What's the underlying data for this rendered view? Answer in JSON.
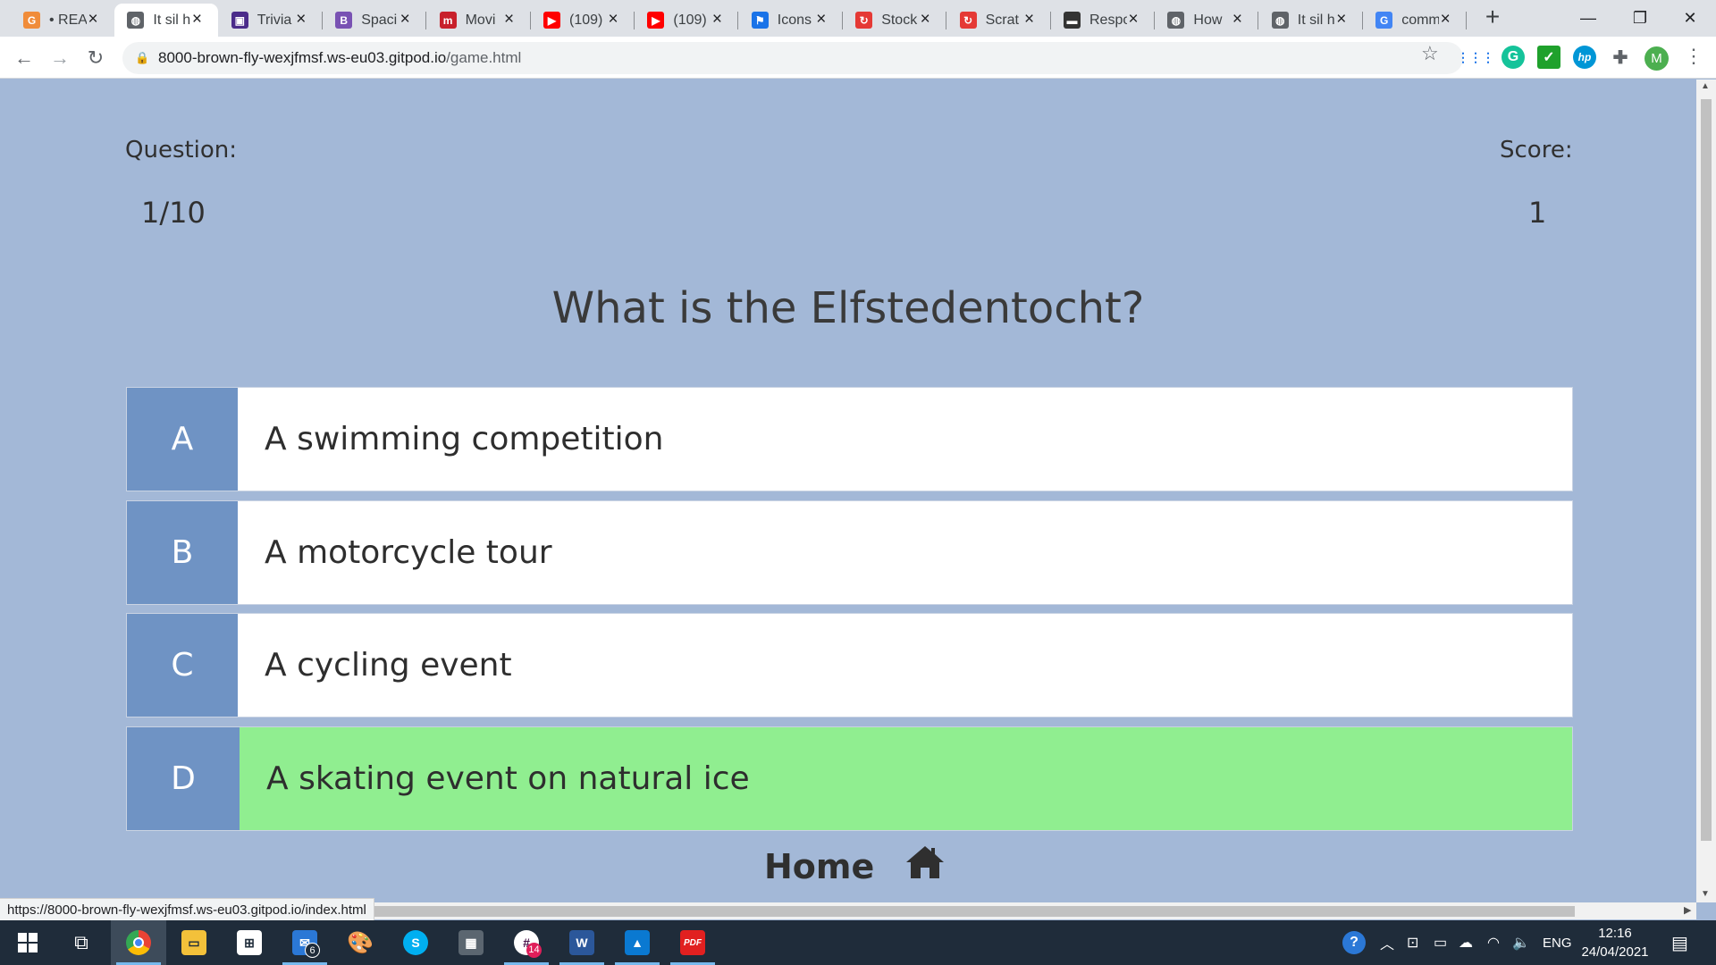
{
  "browser": {
    "tabs": [
      {
        "title": "• REA",
        "favicon": "grammarly-icon",
        "color": "#f08c3a",
        "glyph": "G",
        "active": false
      },
      {
        "title": "It sil h",
        "favicon": "globe-icon",
        "color": "#5f6368",
        "glyph": "◍",
        "active": true
      },
      {
        "title": "Trivia",
        "favicon": "trivia-icon",
        "color": "#4b2c8a",
        "glyph": "▣",
        "active": false
      },
      {
        "title": "Spaci",
        "favicon": "bootstrap-icon",
        "color": "#7952b3",
        "glyph": "B",
        "active": false
      },
      {
        "title": "Movi",
        "favicon": "movie-icon",
        "color": "#c8202b",
        "glyph": "m",
        "active": false
      },
      {
        "title": "(109)",
        "favicon": "youtube-icon",
        "color": "#ff0000",
        "glyph": "▶",
        "active": false
      },
      {
        "title": "(109)",
        "favicon": "youtube-icon",
        "color": "#ff0000",
        "glyph": "▶",
        "active": false
      },
      {
        "title": "Icons",
        "favicon": "flag-icon",
        "color": "#1a73e8",
        "glyph": "⚑",
        "active": false
      },
      {
        "title": "Stock",
        "favicon": "scratch-icon",
        "color": "#e53935",
        "glyph": "↻",
        "active": false
      },
      {
        "title": "Scrat",
        "favicon": "scratch-icon",
        "color": "#e53935",
        "glyph": "↻",
        "active": false
      },
      {
        "title": "Respo",
        "favicon": "keyboard-icon",
        "color": "#333333",
        "glyph": "▬",
        "active": false
      },
      {
        "title": "How",
        "favicon": "globe-icon",
        "color": "#5f6368",
        "glyph": "◍",
        "active": false
      },
      {
        "title": "It sil h",
        "favicon": "globe-icon",
        "color": "#5f6368",
        "glyph": "◍",
        "active": false
      },
      {
        "title": "comm",
        "favicon": "google-icon",
        "color": "#4285f4",
        "glyph": "G",
        "active": false
      }
    ],
    "new_tab": "+",
    "url_host": "8000-brown-fly-wexjfmsf.ws-eu03.gitpod.io",
    "url_path": "/game.html",
    "profile_initial": "M",
    "status_url": "https://8000-brown-fly-wexjfmsf.ws-eu03.gitpod.io/index.html"
  },
  "game": {
    "question_label": "Question:",
    "question_progress": "1/10",
    "score_label": "Score:",
    "score": "1",
    "question": "What is the Elfstedentocht?",
    "choices": [
      {
        "prefix": "A",
        "text": "A swimming competition",
        "state": "default"
      },
      {
        "prefix": "B",
        "text": "A motorcycle tour",
        "state": "default"
      },
      {
        "prefix": "C",
        "text": "A cycling event",
        "state": "default"
      },
      {
        "prefix": "D",
        "text": "A skating event on natural ice",
        "state": "correct"
      }
    ],
    "home_label": "Home",
    "colors": {
      "page_bg": "#a3b8d7",
      "prefix_bg": "#6f93c4",
      "correct_bg": "#90ee90"
    }
  },
  "taskbar": {
    "mail_badge": "6",
    "slack_badge": "14",
    "language": "ENG",
    "time": "12:16",
    "date": "24/04/2021"
  }
}
